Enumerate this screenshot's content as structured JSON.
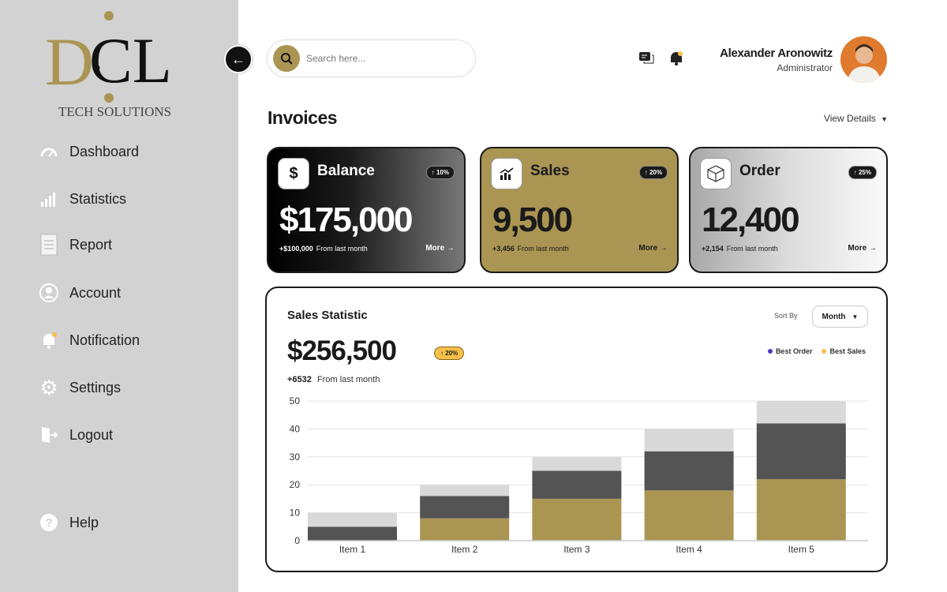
{
  "brand": {
    "logo_letters": "DCL",
    "tagline": "TECH SOLUTIONS"
  },
  "sidebar": {
    "items": [
      {
        "label": "Dashboard",
        "icon": "gauge-icon"
      },
      {
        "label": "Statistics",
        "icon": "bar-chart-icon"
      },
      {
        "label": "Report",
        "icon": "document-icon"
      },
      {
        "label": "Account",
        "icon": "user-circle-icon"
      },
      {
        "label": "Notification",
        "icon": "bell-icon"
      },
      {
        "label": "Settings",
        "icon": "gear-icon"
      },
      {
        "label": "Logout",
        "icon": "door-exit-icon"
      }
    ],
    "help": {
      "label": "Help",
      "icon": "question-icon"
    }
  },
  "header": {
    "search_placeholder": "Search here...",
    "user_name": "Alexander Aronowitz",
    "user_role": "Administrator"
  },
  "invoices": {
    "title": "Invoices",
    "view_details": "View Details"
  },
  "cards": [
    {
      "title": "Balance",
      "badge": "10%",
      "value": "$175,000",
      "delta": "+$100,000",
      "from": "From last month",
      "more": "More"
    },
    {
      "title": "Sales",
      "badge": "20%",
      "value": "9,500",
      "delta": "+3,456",
      "from": "From last month",
      "more": "More"
    },
    {
      "title": "Order",
      "badge": "25%",
      "value": "12,400",
      "delta": "+2,154",
      "from": "From last month",
      "more": "More"
    }
  ],
  "colors": {
    "gold": "#ab9553",
    "dark": "#545454",
    "light": "#d9d9d9",
    "badge_yellow": "#f5c04a",
    "legend_order": "#4b3bbf",
    "legend_sales": "#f5c04a"
  },
  "sales_statistic": {
    "title": "Sales Statistic",
    "sort_by_label": "Sort By",
    "sort_value": "Month",
    "total": "$256,500",
    "badge": "20%",
    "delta": "+6532",
    "from": "From last month",
    "legend": [
      "Best Order",
      "Best Sales"
    ]
  },
  "chart_data": {
    "type": "bar",
    "stacked": true,
    "categories": [
      "Item 1",
      "Item 2",
      "Item 3",
      "Item 4",
      "Item 5"
    ],
    "series": [
      {
        "values": [
          0,
          8,
          15,
          18,
          22
        ],
        "color": "#ab9553"
      },
      {
        "values": [
          5,
          8,
          10,
          14,
          20
        ],
        "color": "#545454"
      },
      {
        "values": [
          5,
          4,
          5,
          8,
          8
        ],
        "color": "#d9d9d9"
      }
    ],
    "ylim": [
      0,
      50
    ],
    "yticks": [
      0,
      10,
      20,
      30,
      40,
      50
    ],
    "grid": true,
    "legend_placement": "top-right"
  }
}
